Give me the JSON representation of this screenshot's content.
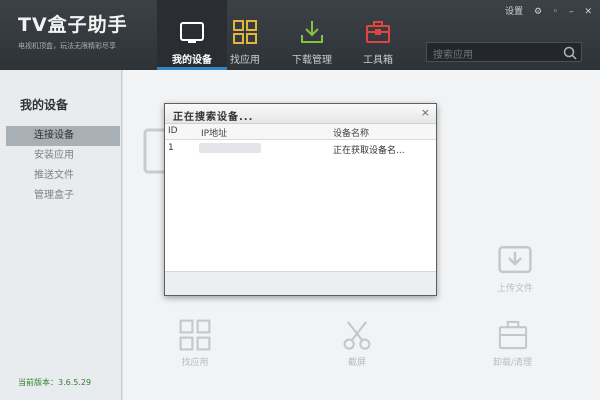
{
  "app": {
    "title": "TV盒子助手",
    "slogan": "电视机顶盒，玩法无限精彩尽享"
  },
  "nav": [
    {
      "label": "我的设备",
      "icon": "tablet-icon",
      "active": true
    },
    {
      "label": "找应用",
      "icon": "grid-icon",
      "active": false
    },
    {
      "label": "下载管理",
      "icon": "download-icon",
      "active": false
    },
    {
      "label": "工具箱",
      "icon": "toolbox-icon",
      "active": false
    }
  ],
  "window_controls": {
    "settings": "设置",
    "icons": [
      "gear-icon",
      "restore-icon",
      "minimize-icon",
      "close-icon"
    ]
  },
  "search": {
    "placeholder": "搜索应用"
  },
  "sidebar": {
    "heading": "我的设备",
    "items": [
      {
        "label": "连接设备",
        "active": true
      },
      {
        "label": "安装应用",
        "active": false
      },
      {
        "label": "推送文件",
        "active": false
      },
      {
        "label": "管理盒子",
        "active": false
      }
    ],
    "version": "当前版本：3.6.5.29"
  },
  "main": {
    "ghost_items": [
      "找应用",
      "截屏",
      "上传文件",
      "卸载/清理"
    ]
  },
  "modal": {
    "title": "正在搜索设备...",
    "close": "×",
    "columns": [
      "ID",
      "IP地址",
      "设备名称"
    ],
    "rows": [
      {
        "id": "1",
        "ip": "",
        "name": "正在获取设备名..."
      }
    ]
  },
  "colors": {
    "accent": "#2d87c9",
    "topbar": "#33383d",
    "nav_active": "#2a2e33"
  }
}
